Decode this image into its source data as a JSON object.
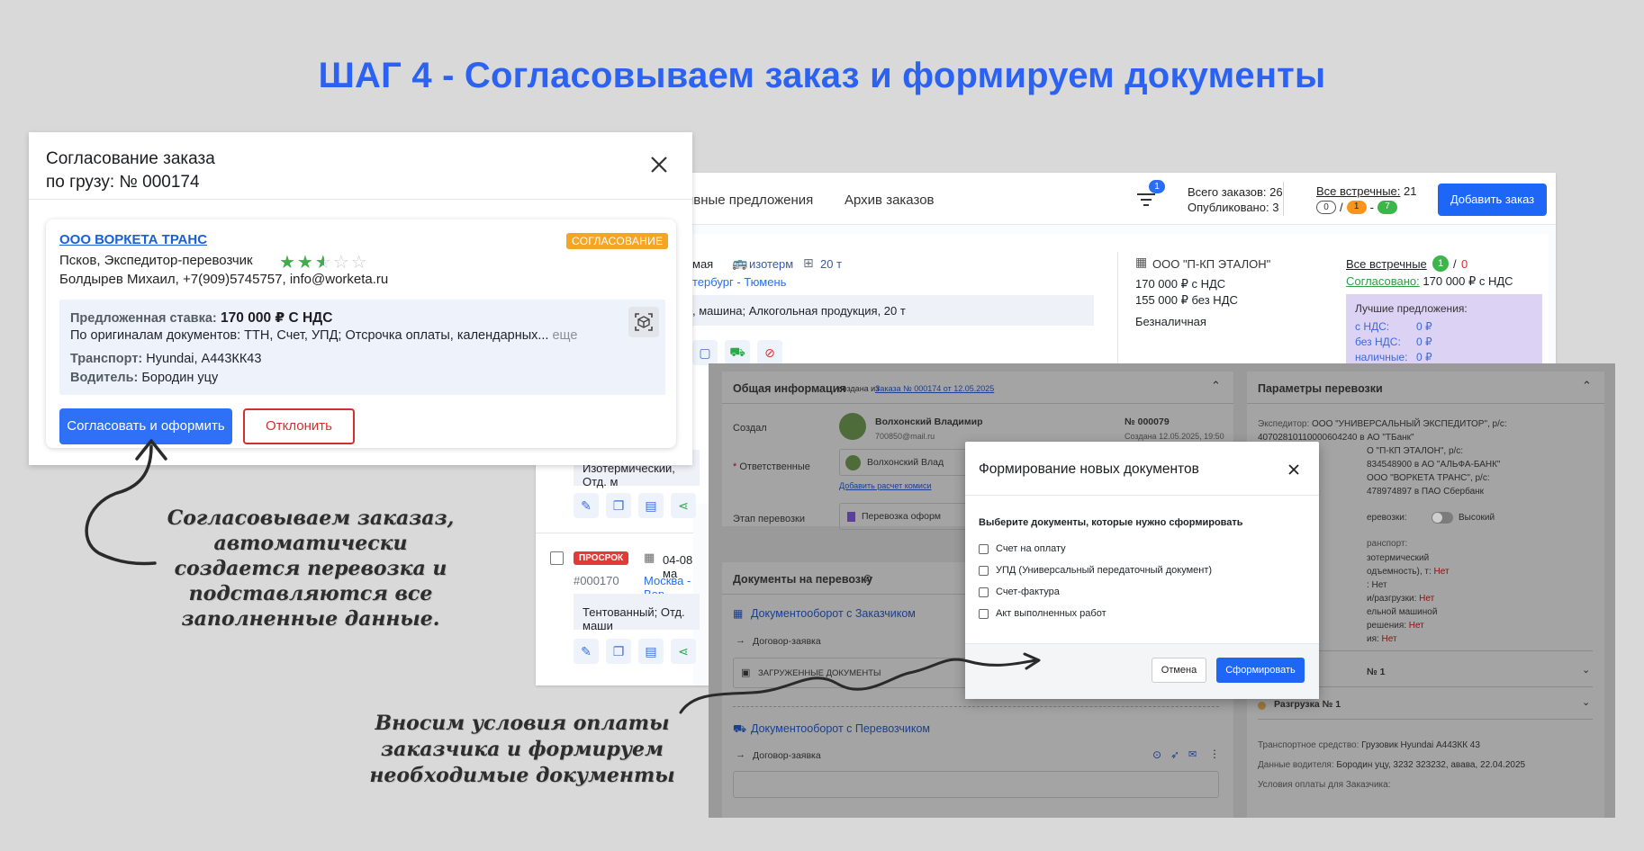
{
  "title": "ШАГ 4 - Согласовываем заказ и формируем документы",
  "colors": {
    "accent": "#2b62f2",
    "primary_button": "#1e66f5",
    "reject": "#d32f2f",
    "badge_orange": "#f5a524",
    "star": "#3fae49"
  },
  "orders": {
    "tabs": [
      "тивные предложения",
      "Архив заказов"
    ],
    "filter_badge": "1",
    "total_orders": "Всего заказов: 26",
    "published": "Опубликовано: 3",
    "all_counter_label": "Все встречные:",
    "all_counter_value": " 21",
    "pills": [
      "0",
      "1",
      "7"
    ],
    "pill_sep1": "/",
    "pill_sep2": "-",
    "add_order": "Добавить заказ",
    "card": {
      "date": "мая",
      "vehicle": "изотерм",
      "weight": "20 т",
      "route": "тербург - Тюмень",
      "cargo": ", машина; Алкогольная продукция, 20 т",
      "company": "ООО \"П-КП ЭТАЛОН\"",
      "price_vat": "170 000 ₽ с НДС",
      "price_novat": "155 000 ₽ без НДС",
      "payment": "Безналичная",
      "counter_link": "Все встречные",
      "counter_green": "1",
      "counter_sep": "/",
      "counter_red": "0",
      "agreed_link": "Согласовано:",
      "agreed_value": " 170 000 ₽ с НДС",
      "best_title": "Лучшие предложения:",
      "best_rows": [
        {
          "label": "с НДС:",
          "value": "0 ₽"
        },
        {
          "label": "без НДС:",
          "value": "0 ₽"
        },
        {
          "label": "наличные:",
          "value": "0 ₽"
        }
      ]
    },
    "list": {
      "row1_cargo": "Изотермический, Отд. м",
      "overdue_badge": "ПРОСРОК",
      "row2_date": "04-08 ма",
      "row2_id": "#000170",
      "row2_route": "Москва - Вор",
      "row2_cargo": "Тентованный; Отд. маши"
    }
  },
  "approval": {
    "title_line1": "Согласование заказа",
    "title_line2": "по грузу: № 000174",
    "company": "ООО ВОРКЕТА ТРАНС",
    "status": "СОГЛАСОВАНИЕ",
    "location": "Псков, Экспедитор-перевозчик",
    "contact": "Болдырев Михаил, +7(909)5745757, info@worketa.ru",
    "rating": 2.5,
    "rate_label": "Предложенная ставка:",
    "rate_value": " 170 000 ₽ С НДС",
    "docs_line": "По оригиналам документов: ТТН, Счет, УПД; Отсрочка оплаты, календарных...",
    "more": " еще",
    "transport_label": "Транспорт:",
    "transport_value": " Hyundai, А443КК43",
    "driver_label": "Водитель:",
    "driver_value": " Бородин уцу",
    "approve_button": "Согласовать и оформить",
    "reject_button": "Отклонить"
  },
  "shipment": {
    "general_title": "Общая информация",
    "created_from": "создана из",
    "order_link": "Заказа № 000174 от 12.05.2025",
    "created_label": "Создал",
    "creator_name": "Волхонский Владимир",
    "creator_email": "700850@mail.ru",
    "number": "№ 000079",
    "created_at": "Создана 12.05.2025, 19:50",
    "responsible_label": "Ответственные",
    "responsible_name": "Волхонский Влад",
    "commission_link": "Добавить расчет комиси",
    "stage_label": "Этап перевозки",
    "stage_value": "Перевозка оформ",
    "docs_title": "Документы на перевозку",
    "customer_flow": "Документооборот с Заказчиком",
    "contract": "Договор-заявка",
    "uploaded": "ЗАГРУЖЕННЫЕ ДОКУМЕНТЫ",
    "carrier_flow": "Документооборот с Перевозчиком",
    "contract2": "Договор-заявка",
    "params_title": "Параметры перевозки",
    "expeditor_label": "Экспедитор:",
    "expeditor_text": " ООО \"УНИВЕРСАЛЬНЫЙ ЭКСПЕДИТОР\", р/с:",
    "acc1": "40702810110000604240 в АО \"ТБанк\"",
    "p2": "О \"П-КП ЭТАЛОН\", р/с:",
    "p3": "834548900 в АО \"АЛЬФА-БАНК\"",
    "p4": "ООО \"ВОРКЕТА ТРАНС\", р/с:",
    "p5": "478974897 в ПАО Сбербанк",
    "priority_label": "еревозки:",
    "priority_value": "Высокий",
    "transport_label": "ранспорт:",
    "t1": "зотермический",
    "t2": "одъемность), т:",
    "t2v": " Нет",
    "t3": ": Нет",
    "t4": "и/разгрузки:",
    "t4v": " Нет",
    "t5": "ельной машиной",
    "t6": "решения:",
    "t6v": " Нет",
    "t7": "ия:",
    "t7v": " Нет",
    "load": "№ 1",
    "unload": "Разгрузка № 1",
    "vehicle_label": "Транспортное средство:",
    "vehicle_value": " Грузовик Hyundai А443КК 43",
    "driver_label": "Данные водителя:",
    "driver_value": " Бородин уцу, 3232 323232, авава, 22.04.2025",
    "payment_label": "Условия оплаты для Заказчика:"
  },
  "docs_modal": {
    "title": "Формирование новых документов",
    "subtitle": "Выберите документы, которые нужно сформировать",
    "options": [
      "Счет на оплату",
      "УПД (Универсальный передаточный документ)",
      "Счет-фактура",
      "Акт выполненных работ"
    ],
    "cancel": "Отмена",
    "submit": "Сформировать"
  },
  "annotations": {
    "note1": [
      "Согласовываем заказаз,",
      "автоматически",
      "создается перевозка и",
      "подставляются все",
      "заполненные данные."
    ],
    "note2": [
      "Вносим условия оплаты",
      "заказчика и формируем",
      "необходимые документы"
    ]
  }
}
